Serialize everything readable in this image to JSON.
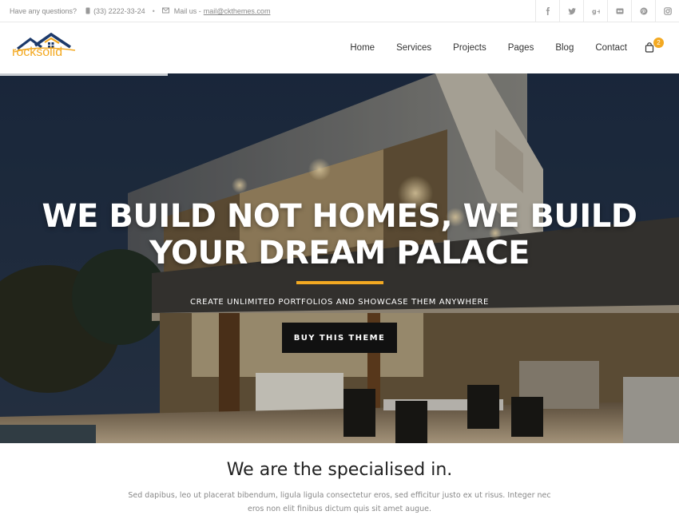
{
  "topbar": {
    "question": "Have any questions?",
    "phone": "(33) 2222-33-24",
    "bullet": "•",
    "mail_label": "Mail us -",
    "mail_address": "mail@ckthemes.com",
    "social": [
      "facebook-icon",
      "twitter-icon",
      "google-plus-icon",
      "flickr-icon",
      "pinterest-icon",
      "instagram-icon"
    ]
  },
  "header": {
    "logo_text": "rocksolid",
    "nav": [
      "Home",
      "Services",
      "Projects",
      "Pages",
      "Blog",
      "Contact"
    ],
    "cart_count": "2"
  },
  "hero": {
    "title_line1": "WE BUILD NOT HOMES, WE BUILD",
    "title_line2": "YOUR DREAM PALACE",
    "subtitle": "CREATE UNLIMITED PORTFOLIOS AND SHOWCASE THEM ANYWHERE",
    "button": "BUY THIS THEME"
  },
  "section": {
    "title": "We are the specialised in.",
    "text": "Sed dapibus, leo ut placerat bibendum, ligula ligula consectetur eros, sed efficitur justo ex ut risus. Integer nec eros non elit finibus dictum quis sit amet augue."
  },
  "colors": {
    "accent": "#f3a922",
    "dark": "#111111",
    "text_muted": "#888888"
  }
}
